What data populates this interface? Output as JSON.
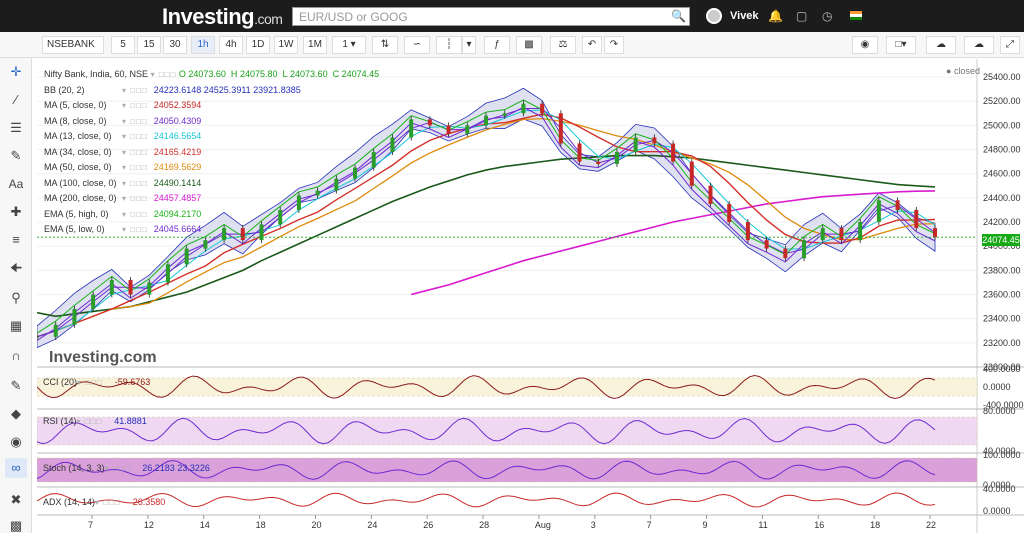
{
  "header": {
    "logo_main": "Investing",
    "logo_suffix": ".com",
    "search_placeholder": "EUR/USD or GOOG",
    "user": "Vivek"
  },
  "toolbar": {
    "symbol": "NSEBANK",
    "intervals": [
      "5",
      "15",
      "30",
      "1h",
      "4h",
      "1D",
      "1W",
      "1M"
    ],
    "selected_interval": "1h",
    "count": "1"
  },
  "chart": {
    "title": "Nifty Bank, India, 60, NSE",
    "ohlc": {
      "o_label": "O",
      "o": "24073.60",
      "h_label": "H",
      "h": "24075.80",
      "l_label": "L",
      "l": "24073.60",
      "c_label": "C",
      "c": "24074.45"
    },
    "status": "closed",
    "last_price": "24074.45",
    "watermark": "Investing",
    "watermark_suffix": ".com",
    "indicators": [
      {
        "name": "BB (20, 2)",
        "value": "24223.6148  24525.3911  23921.8385",
        "color": "#2630b8"
      },
      {
        "name": "MA (5, close, 0)",
        "value": "24052.3594",
        "color": "#c62828"
      },
      {
        "name": "MA (8, close, 0)",
        "value": "24050.4309",
        "color": "#6f2ad1"
      },
      {
        "name": "MA (13, close, 0)",
        "value": "24146.5654",
        "color": "#17c7d4"
      },
      {
        "name": "MA (34, close, 0)",
        "value": "24165.4219",
        "color": "#d4302a"
      },
      {
        "name": "MA (50, close, 0)",
        "value": "24169.5629",
        "color": "#e08a0c"
      },
      {
        "name": "MA (100, close, 0)",
        "value": "24490.1414",
        "color": "#1b5a1b"
      },
      {
        "name": "MA (200, close, 0)",
        "value": "24457.4857",
        "color": "#d91ad0"
      },
      {
        "name": "EMA (5, high, 0)",
        "value": "24094.2170",
        "color": "#18b318"
      },
      {
        "name": "EMA (5, low, 0)",
        "value": "24045.6664",
        "color": "#6f2ad1"
      }
    ],
    "panels": [
      {
        "name": "CCI (20)",
        "value": "-59.6763",
        "color": "#8a1a1a"
      },
      {
        "name": "RSI (14)",
        "value": "41.8881",
        "color": "#2630b8"
      },
      {
        "name": "Stoch (14, 3, 3)",
        "value": "26.2183  23.3226",
        "color": "#2630b8"
      },
      {
        "name": "ADX (14, 14)",
        "value": "26.3580",
        "color": "#c62828"
      }
    ]
  },
  "chart_data": {
    "type": "line",
    "price_axis": [
      "25400.00",
      "25200.00",
      "25000.00",
      "24800.00",
      "24600.00",
      "24400.00",
      "24200.00",
      "24000.00",
      "23800.00",
      "23600.00",
      "23400.00",
      "23200.00",
      "23000.00"
    ],
    "ylim": [
      23000,
      25450
    ],
    "x_ticks": [
      "7",
      "12",
      "14",
      "18",
      "20",
      "24",
      "26",
      "28",
      "Aug",
      "3",
      "7",
      "9",
      "11",
      "16",
      "18",
      "22"
    ],
    "cci_axis": [
      "400.0000",
      "0.0000",
      "-400.0000"
    ],
    "rsi_axis": [
      "80.0000",
      "40.0000"
    ],
    "stoch_axis": [
      "100.0000",
      "0.0000"
    ],
    "adx_axis": [
      "40.0000",
      "0.0000"
    ],
    "price_series": [
      23250,
      23350,
      23480,
      23600,
      23720,
      23600,
      23700,
      23850,
      23980,
      24050,
      24150,
      24050,
      24180,
      24300,
      24420,
      24460,
      24560,
      24650,
      24780,
      24900,
      25050,
      25000,
      24930,
      25000,
      25080,
      25100,
      25180,
      25100,
      24850,
      24700,
      24680,
      24780,
      24900,
      24850,
      24700,
      24500,
      24350,
      24200,
      24050,
      23980,
      23900,
      24050,
      24150,
      24050,
      24200,
      24380,
      24300,
      24150,
      24074
    ],
    "ma200": [
      null,
      null,
      null,
      null,
      null,
      null,
      null,
      null,
      null,
      null,
      null,
      null,
      null,
      null,
      null,
      null,
      null,
      null,
      null,
      null,
      23600,
      23640,
      23680,
      23730,
      23780,
      23830,
      23880,
      23920,
      23960,
      24000,
      24040,
      24080,
      24120,
      24160,
      24200,
      24230,
      24260,
      24290,
      24320,
      24350,
      24370,
      24390,
      24410,
      24420,
      24430,
      24440,
      24450,
      24455,
      24457
    ],
    "ma100": [
      23450,
      23420,
      23440,
      23460,
      23480,
      23500,
      23540,
      23580,
      23620,
      23680,
      23740,
      23800,
      23880,
      23950,
      24020,
      24090,
      24160,
      24230,
      24300,
      24370,
      24430,
      24490,
      24540,
      24590,
      24630,
      24660,
      24680,
      24700,
      24720,
      24730,
      24740,
      24750,
      24750,
      24750,
      24740,
      24730,
      24710,
      24690,
      24670,
      24650,
      24630,
      24610,
      24590,
      24570,
      24550,
      24530,
      24510,
      24500,
      24490
    ]
  }
}
